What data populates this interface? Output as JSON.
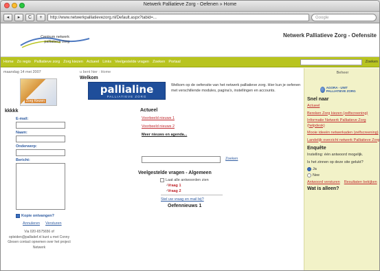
{
  "window": {
    "title": "Netwerk Palliatieve Zorg - Oefenen » Home",
    "url": "http://www.netwerkpalliatievezorg.nl/Default.aspx?tabid=...",
    "search_placeholder": "Google",
    "back": "◂",
    "forward": "▸",
    "reload": "C",
    "add": "+"
  },
  "header": {
    "logo_text": "Centrum netwerk palliatieve zorg",
    "site_title": "Netwerk Palliatieve Zorg - Oefensite"
  },
  "nav": {
    "items": [
      "Home",
      "Zo regio",
      "Palliatieve zorg",
      "Zorg kiezen",
      "Actueel",
      "Links",
      "Veelgestelde vragen",
      "Zoeken",
      "Portaal"
    ],
    "search_label": "Zoeken"
  },
  "left": {
    "date": "maandag 14 mei 2007",
    "image_label": "Zorg Kiezen",
    "section_title": "kkkkk",
    "fields": {
      "email": "E-mail:",
      "name": "Naam:",
      "subject": "Onderwerp:",
      "message": "Bericht:"
    },
    "copy_label": "Kopie ontvangen?",
    "submit": "Annuleren",
    "send": "Versturen",
    "footnote": "Via 020-6575656 of opleiden@palliatief.nl kunt u met Conny Glesen contact opnemen over het project Netwerk"
  },
  "main": {
    "breadcrumb": "u bent hier : Home",
    "welkom": "Welkom",
    "banner_word": "pallialine",
    "banner_sub": "PALLIATIEVE ZORG",
    "intro": "Welkom op de oefensite van het netwerk palliatieve zorg. Hier kun je oefenen met verschillende modules, pagina's, instellingen en accounts.",
    "actueel": "Actueel",
    "news": [
      "Voorbeeld nieuws 1",
      "Voorbeeld nieuws 2"
    ],
    "more_news": "Meer nieuws en agenda...",
    "search_button": "Zoeken",
    "faq_title": "Veelgestelde vragen - Algemeen",
    "faq_show_all": "Laat alle antwoorden zien",
    "faq_items": [
      "Vraag 1",
      "Vraag 2"
    ],
    "faq_more": "Stel uw vraag en mail bij?",
    "oefen": "Oefennieuws 1"
  },
  "right": {
    "beheer": "Beheer",
    "agora": "AGORA - UNIT PALLIATIEVE ZORG",
    "snel_title": "Snel naar",
    "links": [
      "Actueel",
      "Bereken Zorg kiezen (zelfscreening)",
      "Informatie Netwerk Palliatieve Zorg (helpdesk)",
      "Mooie ideeën netwerkaden (zelfscreening)",
      "Landelijk overzicht netwerk Palliatieve Zorg"
    ],
    "poll_title": "Enquête",
    "poll_text": "Instelling: één antwoord mogelijk.",
    "poll_question": "Is het zinnen op deze site gelukt?",
    "poll_options": [
      "Ja",
      "Nee"
    ],
    "poll_submit": "Antwoord versturen",
    "poll_results": "Resultaten bekijken",
    "last": "Wat is alleen?"
  },
  "colors": {
    "nav": "#b8c41f",
    "link_red": "#c0282d",
    "link_blue": "#2d5aa0",
    "right_bg": "#f2f2c8",
    "banner": "#1f4e9a"
  }
}
